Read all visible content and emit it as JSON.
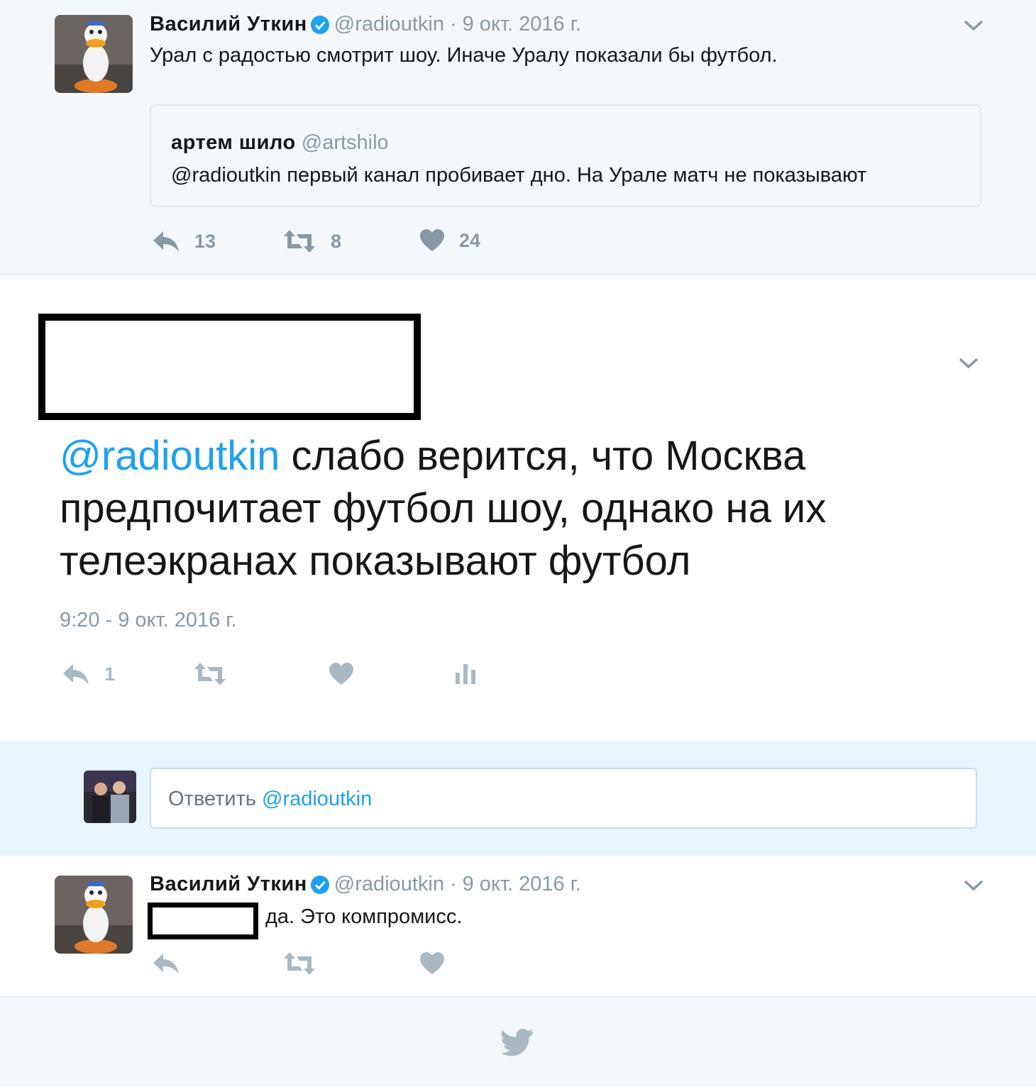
{
  "top_tweet": {
    "fullname": "Василий Уткин",
    "screen_name": "@radioutkin",
    "separator": "·",
    "date": "9 окт. 2016 г.",
    "text": "Урал с радостью смотрит шоу. Иначе Уралу показали бы футбол.",
    "quote": {
      "fullname": "артем шило",
      "screen_name": "@artshilo",
      "text": "@radioutkin первый канал пробивает дно. На Урале матч не показывают"
    },
    "reply_count": "13",
    "retweet_count": "8",
    "like_count": "24"
  },
  "main_tweet": {
    "mention": "@radioutkin",
    "text": " слабо верится, что Москва предпочитает футбол шоу, однако на их телеэкранах показывают футбол",
    "timestamp": "9:20 - 9 окт. 2016 г.",
    "reply_count": "1"
  },
  "reply_box": {
    "placeholder_prefix": "Ответить ",
    "placeholder_mention": "@radioutkin"
  },
  "bottom_tweet": {
    "fullname": "Василий Уткин",
    "screen_name": "@radioutkin",
    "separator": "·",
    "date": "9 окт. 2016 г.",
    "text": "да. Это компромисс."
  },
  "colors": {
    "accent": "#1da1f2",
    "muted": "#8899a6",
    "text": "#14171a",
    "background": "#f5f8fa",
    "reply_bg": "#e8f5fd"
  },
  "icons": [
    "avatar-duck",
    "verified-icon",
    "chevron-down-icon",
    "reply-icon",
    "retweet-icon",
    "heart-icon",
    "analytics-icon",
    "twitter-bird-icon"
  ]
}
